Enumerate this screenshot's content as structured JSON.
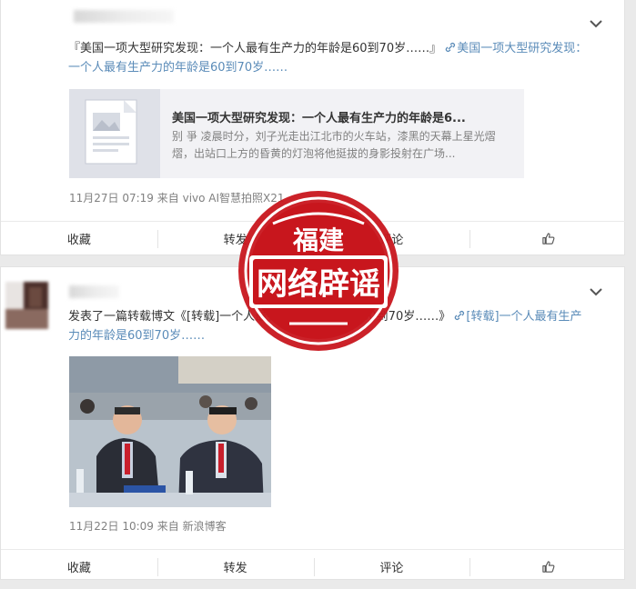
{
  "feed": {
    "post1": {
      "text_prefix": "『美国一项大型研究发现：一个人最有生产力的年龄是60到70岁……』",
      "link_text": "美国一项大型研究发现：一个人最有生产力的年龄是60到70岁……",
      "share_card": {
        "title": "美国一项大型研究发现：一个人最有生产力的年龄是6...",
        "description": "别 爭 凌晨时分，刘子光走出江北市的火车站，漆黑的天幕上星光熠熠，出站口上方的昏黄的灯泡将他挺拔的身影投射在广场..."
      },
      "time": "11月27日 07:19",
      "source_prefix": "来自",
      "source": "vivo AI智慧拍照X21"
    },
    "post2": {
      "text_prefix": "发表了一篇转载博文《[转载]一个人最有生产力的年龄是60到70岁……》",
      "link_text": "[转载]一个人最有生产力的年龄是60到70岁……",
      "time": "11月22日 10:09",
      "source_prefix": "来自",
      "source": "新浪博客"
    },
    "actions": {
      "favorite": "收藏",
      "repost": "转发",
      "comment": "评论"
    }
  },
  "stamp": {
    "top_text": "福建",
    "main_text": "网络辟谣",
    "color": "#c8161d"
  },
  "colors": {
    "link": "#5a8bb8",
    "meta": "#808080",
    "background": "#eaeaea"
  }
}
